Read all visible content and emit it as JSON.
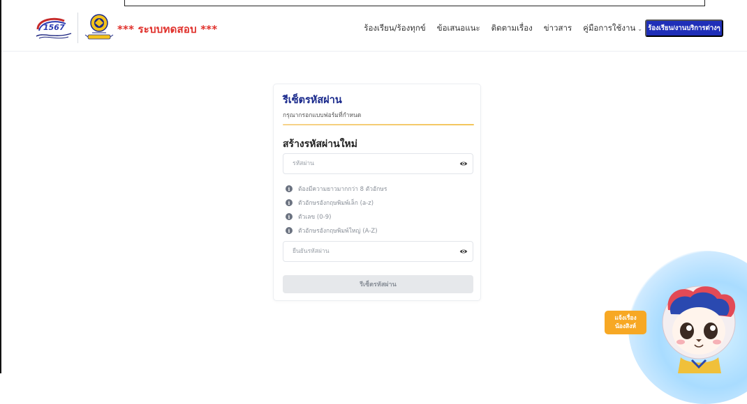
{
  "header": {
    "site_title": "*** ระบบทดสอบ ***",
    "logo_text": "1567",
    "nav": [
      {
        "label": "ร้องเรียน/ร้องทุกข์"
      },
      {
        "label": "ข้อเสนอแนะ"
      },
      {
        "label": "ติดตามเรื่อง"
      },
      {
        "label": "ข่าวสาร"
      },
      {
        "label": "คู่มือการใช้งาน",
        "chevron": "⌄"
      }
    ],
    "cta_label": "ร้องเรียน/งานบริการต่างๆ"
  },
  "card": {
    "title": "รีเซ็ตรหัสผ่าน",
    "subtitle": "กรุณากรอกแบบฟอร์มที่กำหนด",
    "section_title": "สร้างรหัสผ่านใหม่",
    "password": {
      "value": "",
      "placeholder": "รหัสผ่าน"
    },
    "confirm": {
      "value": "",
      "placeholder": "ยืนยันรหัสผ่าน"
    },
    "rules": [
      {
        "icon": "i",
        "text": "ต้องมีความยาวมากกว่า 8 ตัวอักษร"
      },
      {
        "icon": "i",
        "text": "ตัวอักษรอังกฤษพิมพ์เล็ก (a-z)"
      },
      {
        "icon": "i",
        "text": "ตัวเลข (0-9)"
      },
      {
        "icon": "i",
        "text": "ตัวอักษรอังกฤษพิมพ์ใหญ่ (A-Z)"
      }
    ],
    "submit_label": "รีเซ็ตรหัสผ่าน"
  },
  "chat": {
    "line1": "แจ้งเรื่อง",
    "line2": "น้องสิงห์"
  },
  "colors": {
    "brand": "#1f2fb8",
    "title_red": "#e0302b",
    "accent_gold": "#f3c55a",
    "chat_orange": "#f7a824"
  }
}
